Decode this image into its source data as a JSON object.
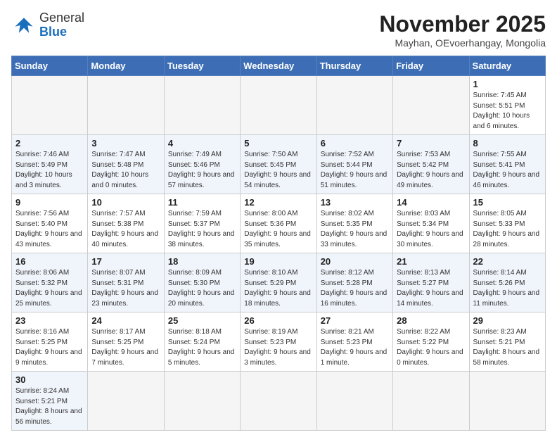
{
  "header": {
    "logo_general": "General",
    "logo_blue": "Blue",
    "month_title": "November 2025",
    "location": "Mayhan, OEvoerhangay, Mongolia"
  },
  "weekdays": [
    "Sunday",
    "Monday",
    "Tuesday",
    "Wednesday",
    "Thursday",
    "Friday",
    "Saturday"
  ],
  "weeks": [
    [
      {
        "day": "",
        "info": ""
      },
      {
        "day": "",
        "info": ""
      },
      {
        "day": "",
        "info": ""
      },
      {
        "day": "",
        "info": ""
      },
      {
        "day": "",
        "info": ""
      },
      {
        "day": "",
        "info": ""
      },
      {
        "day": "1",
        "info": "Sunrise: 7:45 AM\nSunset: 5:51 PM\nDaylight: 10 hours and 6 minutes."
      }
    ],
    [
      {
        "day": "2",
        "info": "Sunrise: 7:46 AM\nSunset: 5:49 PM\nDaylight: 10 hours and 3 minutes."
      },
      {
        "day": "3",
        "info": "Sunrise: 7:47 AM\nSunset: 5:48 PM\nDaylight: 10 hours and 0 minutes."
      },
      {
        "day": "4",
        "info": "Sunrise: 7:49 AM\nSunset: 5:46 PM\nDaylight: 9 hours and 57 minutes."
      },
      {
        "day": "5",
        "info": "Sunrise: 7:50 AM\nSunset: 5:45 PM\nDaylight: 9 hours and 54 minutes."
      },
      {
        "day": "6",
        "info": "Sunrise: 7:52 AM\nSunset: 5:44 PM\nDaylight: 9 hours and 51 minutes."
      },
      {
        "day": "7",
        "info": "Sunrise: 7:53 AM\nSunset: 5:42 PM\nDaylight: 9 hours and 49 minutes."
      },
      {
        "day": "8",
        "info": "Sunrise: 7:55 AM\nSunset: 5:41 PM\nDaylight: 9 hours and 46 minutes."
      }
    ],
    [
      {
        "day": "9",
        "info": "Sunrise: 7:56 AM\nSunset: 5:40 PM\nDaylight: 9 hours and 43 minutes."
      },
      {
        "day": "10",
        "info": "Sunrise: 7:57 AM\nSunset: 5:38 PM\nDaylight: 9 hours and 40 minutes."
      },
      {
        "day": "11",
        "info": "Sunrise: 7:59 AM\nSunset: 5:37 PM\nDaylight: 9 hours and 38 minutes."
      },
      {
        "day": "12",
        "info": "Sunrise: 8:00 AM\nSunset: 5:36 PM\nDaylight: 9 hours and 35 minutes."
      },
      {
        "day": "13",
        "info": "Sunrise: 8:02 AM\nSunset: 5:35 PM\nDaylight: 9 hours and 33 minutes."
      },
      {
        "day": "14",
        "info": "Sunrise: 8:03 AM\nSunset: 5:34 PM\nDaylight: 9 hours and 30 minutes."
      },
      {
        "day": "15",
        "info": "Sunrise: 8:05 AM\nSunset: 5:33 PM\nDaylight: 9 hours and 28 minutes."
      }
    ],
    [
      {
        "day": "16",
        "info": "Sunrise: 8:06 AM\nSunset: 5:32 PM\nDaylight: 9 hours and 25 minutes."
      },
      {
        "day": "17",
        "info": "Sunrise: 8:07 AM\nSunset: 5:31 PM\nDaylight: 9 hours and 23 minutes."
      },
      {
        "day": "18",
        "info": "Sunrise: 8:09 AM\nSunset: 5:30 PM\nDaylight: 9 hours and 20 minutes."
      },
      {
        "day": "19",
        "info": "Sunrise: 8:10 AM\nSunset: 5:29 PM\nDaylight: 9 hours and 18 minutes."
      },
      {
        "day": "20",
        "info": "Sunrise: 8:12 AM\nSunset: 5:28 PM\nDaylight: 9 hours and 16 minutes."
      },
      {
        "day": "21",
        "info": "Sunrise: 8:13 AM\nSunset: 5:27 PM\nDaylight: 9 hours and 14 minutes."
      },
      {
        "day": "22",
        "info": "Sunrise: 8:14 AM\nSunset: 5:26 PM\nDaylight: 9 hours and 11 minutes."
      }
    ],
    [
      {
        "day": "23",
        "info": "Sunrise: 8:16 AM\nSunset: 5:25 PM\nDaylight: 9 hours and 9 minutes."
      },
      {
        "day": "24",
        "info": "Sunrise: 8:17 AM\nSunset: 5:25 PM\nDaylight: 9 hours and 7 minutes."
      },
      {
        "day": "25",
        "info": "Sunrise: 8:18 AM\nSunset: 5:24 PM\nDaylight: 9 hours and 5 minutes."
      },
      {
        "day": "26",
        "info": "Sunrise: 8:19 AM\nSunset: 5:23 PM\nDaylight: 9 hours and 3 minutes."
      },
      {
        "day": "27",
        "info": "Sunrise: 8:21 AM\nSunset: 5:23 PM\nDaylight: 9 hours and 1 minute."
      },
      {
        "day": "28",
        "info": "Sunrise: 8:22 AM\nSunset: 5:22 PM\nDaylight: 9 hours and 0 minutes."
      },
      {
        "day": "29",
        "info": "Sunrise: 8:23 AM\nSunset: 5:21 PM\nDaylight: 8 hours and 58 minutes."
      }
    ],
    [
      {
        "day": "30",
        "info": "Sunrise: 8:24 AM\nSunset: 5:21 PM\nDaylight: 8 hours and 56 minutes."
      },
      {
        "day": "",
        "info": ""
      },
      {
        "day": "",
        "info": ""
      },
      {
        "day": "",
        "info": ""
      },
      {
        "day": "",
        "info": ""
      },
      {
        "day": "",
        "info": ""
      },
      {
        "day": "",
        "info": ""
      }
    ]
  ]
}
